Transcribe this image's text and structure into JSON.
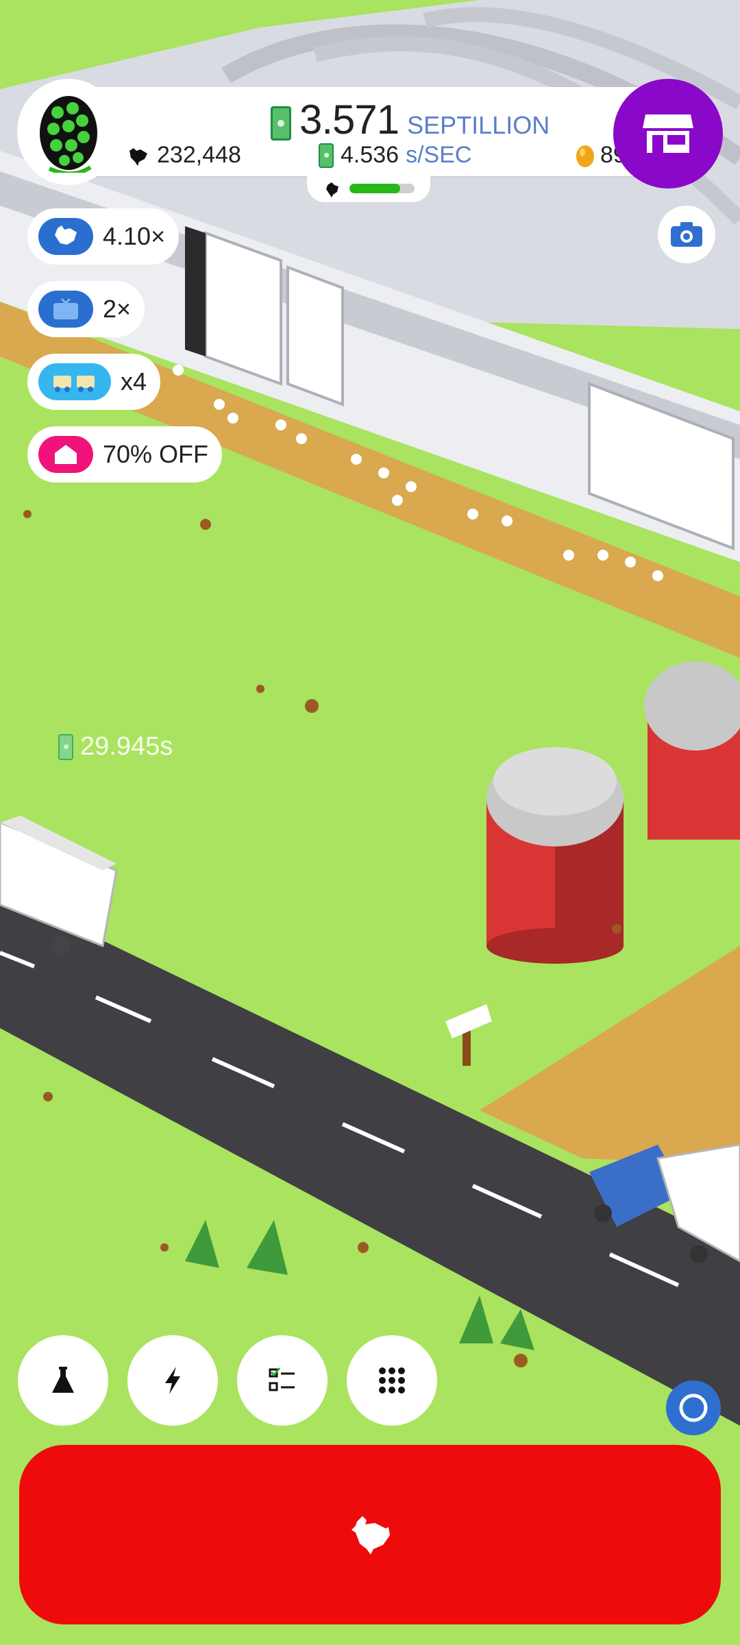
{
  "hud": {
    "cash_amount": "3.571",
    "cash_unit": "SEPTILLION",
    "chicken_count": "232,448",
    "income_rate": "4.536",
    "income_unit": "s/SEC",
    "golden_eggs": "89",
    "hatchery_fill": 0.78
  },
  "boosts": [
    {
      "label": "4.10×",
      "icon": "chicken-icon",
      "color": "#2a6fcf"
    },
    {
      "label": "2×",
      "icon": "tv-icon",
      "color": "#2a6fcf"
    },
    {
      "label": "x4",
      "icon": "vehicles-icon",
      "color": "#35b6ee"
    },
    {
      "label": "70% OFF",
      "icon": "house-icon",
      "color": "#f0137a"
    }
  ],
  "floating_income": "29.945s",
  "bottom_buttons": [
    {
      "name": "research-button",
      "icon": "flask-icon"
    },
    {
      "name": "boost-button",
      "icon": "lightning-icon"
    },
    {
      "name": "missions-button",
      "icon": "checklist-icon"
    },
    {
      "name": "menu-button",
      "icon": "grid-icon"
    }
  ],
  "colors": {
    "grass": "#a9e35f",
    "hatch_button": "#ee0b0b",
    "shop_button": "#8a08c9",
    "accent_blue": "#2e6fd0"
  }
}
